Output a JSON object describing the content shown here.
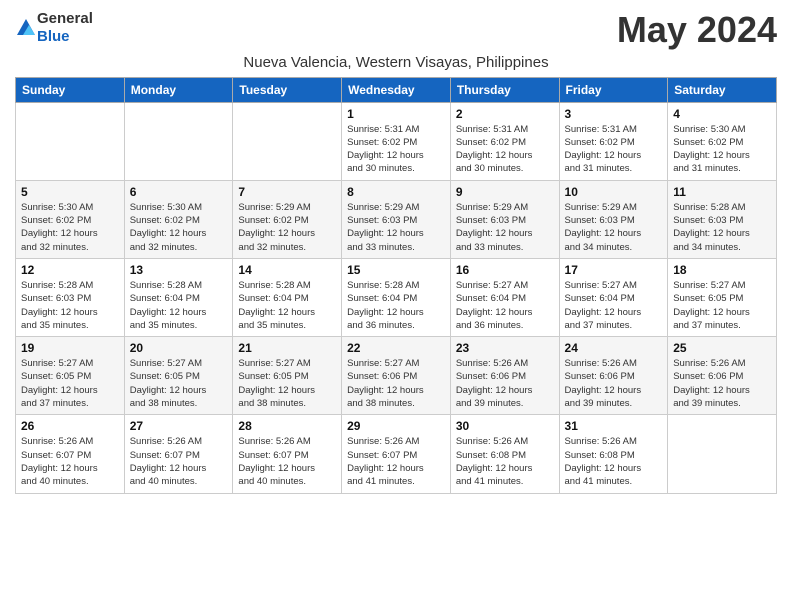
{
  "header": {
    "logo_general": "General",
    "logo_blue": "Blue",
    "month_title": "May 2024",
    "location": "Nueva Valencia, Western Visayas, Philippines"
  },
  "weekdays": [
    "Sunday",
    "Monday",
    "Tuesday",
    "Wednesday",
    "Thursday",
    "Friday",
    "Saturday"
  ],
  "weeks": [
    [
      {
        "day": "",
        "info": ""
      },
      {
        "day": "",
        "info": ""
      },
      {
        "day": "",
        "info": ""
      },
      {
        "day": "1",
        "info": "Sunrise: 5:31 AM\nSunset: 6:02 PM\nDaylight: 12 hours\nand 30 minutes."
      },
      {
        "day": "2",
        "info": "Sunrise: 5:31 AM\nSunset: 6:02 PM\nDaylight: 12 hours\nand 30 minutes."
      },
      {
        "day": "3",
        "info": "Sunrise: 5:31 AM\nSunset: 6:02 PM\nDaylight: 12 hours\nand 31 minutes."
      },
      {
        "day": "4",
        "info": "Sunrise: 5:30 AM\nSunset: 6:02 PM\nDaylight: 12 hours\nand 31 minutes."
      }
    ],
    [
      {
        "day": "5",
        "info": "Sunrise: 5:30 AM\nSunset: 6:02 PM\nDaylight: 12 hours\nand 32 minutes."
      },
      {
        "day": "6",
        "info": "Sunrise: 5:30 AM\nSunset: 6:02 PM\nDaylight: 12 hours\nand 32 minutes."
      },
      {
        "day": "7",
        "info": "Sunrise: 5:29 AM\nSunset: 6:02 PM\nDaylight: 12 hours\nand 32 minutes."
      },
      {
        "day": "8",
        "info": "Sunrise: 5:29 AM\nSunset: 6:03 PM\nDaylight: 12 hours\nand 33 minutes."
      },
      {
        "day": "9",
        "info": "Sunrise: 5:29 AM\nSunset: 6:03 PM\nDaylight: 12 hours\nand 33 minutes."
      },
      {
        "day": "10",
        "info": "Sunrise: 5:29 AM\nSunset: 6:03 PM\nDaylight: 12 hours\nand 34 minutes."
      },
      {
        "day": "11",
        "info": "Sunrise: 5:28 AM\nSunset: 6:03 PM\nDaylight: 12 hours\nand 34 minutes."
      }
    ],
    [
      {
        "day": "12",
        "info": "Sunrise: 5:28 AM\nSunset: 6:03 PM\nDaylight: 12 hours\nand 35 minutes."
      },
      {
        "day": "13",
        "info": "Sunrise: 5:28 AM\nSunset: 6:04 PM\nDaylight: 12 hours\nand 35 minutes."
      },
      {
        "day": "14",
        "info": "Sunrise: 5:28 AM\nSunset: 6:04 PM\nDaylight: 12 hours\nand 35 minutes."
      },
      {
        "day": "15",
        "info": "Sunrise: 5:28 AM\nSunset: 6:04 PM\nDaylight: 12 hours\nand 36 minutes."
      },
      {
        "day": "16",
        "info": "Sunrise: 5:27 AM\nSunset: 6:04 PM\nDaylight: 12 hours\nand 36 minutes."
      },
      {
        "day": "17",
        "info": "Sunrise: 5:27 AM\nSunset: 6:04 PM\nDaylight: 12 hours\nand 37 minutes."
      },
      {
        "day": "18",
        "info": "Sunrise: 5:27 AM\nSunset: 6:05 PM\nDaylight: 12 hours\nand 37 minutes."
      }
    ],
    [
      {
        "day": "19",
        "info": "Sunrise: 5:27 AM\nSunset: 6:05 PM\nDaylight: 12 hours\nand 37 minutes."
      },
      {
        "day": "20",
        "info": "Sunrise: 5:27 AM\nSunset: 6:05 PM\nDaylight: 12 hours\nand 38 minutes."
      },
      {
        "day": "21",
        "info": "Sunrise: 5:27 AM\nSunset: 6:05 PM\nDaylight: 12 hours\nand 38 minutes."
      },
      {
        "day": "22",
        "info": "Sunrise: 5:27 AM\nSunset: 6:06 PM\nDaylight: 12 hours\nand 38 minutes."
      },
      {
        "day": "23",
        "info": "Sunrise: 5:26 AM\nSunset: 6:06 PM\nDaylight: 12 hours\nand 39 minutes."
      },
      {
        "day": "24",
        "info": "Sunrise: 5:26 AM\nSunset: 6:06 PM\nDaylight: 12 hours\nand 39 minutes."
      },
      {
        "day": "25",
        "info": "Sunrise: 5:26 AM\nSunset: 6:06 PM\nDaylight: 12 hours\nand 39 minutes."
      }
    ],
    [
      {
        "day": "26",
        "info": "Sunrise: 5:26 AM\nSunset: 6:07 PM\nDaylight: 12 hours\nand 40 minutes."
      },
      {
        "day": "27",
        "info": "Sunrise: 5:26 AM\nSunset: 6:07 PM\nDaylight: 12 hours\nand 40 minutes."
      },
      {
        "day": "28",
        "info": "Sunrise: 5:26 AM\nSunset: 6:07 PM\nDaylight: 12 hours\nand 40 minutes."
      },
      {
        "day": "29",
        "info": "Sunrise: 5:26 AM\nSunset: 6:07 PM\nDaylight: 12 hours\nand 41 minutes."
      },
      {
        "day": "30",
        "info": "Sunrise: 5:26 AM\nSunset: 6:08 PM\nDaylight: 12 hours\nand 41 minutes."
      },
      {
        "day": "31",
        "info": "Sunrise: 5:26 AM\nSunset: 6:08 PM\nDaylight: 12 hours\nand 41 minutes."
      },
      {
        "day": "",
        "info": ""
      }
    ]
  ]
}
